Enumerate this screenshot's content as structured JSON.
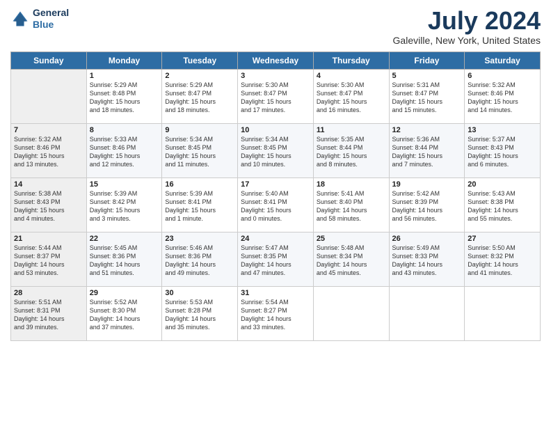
{
  "logo": {
    "line1": "General",
    "line2": "Blue"
  },
  "header": {
    "month": "July 2024",
    "location": "Galeville, New York, United States"
  },
  "days_of_week": [
    "Sunday",
    "Monday",
    "Tuesday",
    "Wednesday",
    "Thursday",
    "Friday",
    "Saturday"
  ],
  "weeks": [
    [
      {
        "num": "",
        "info": ""
      },
      {
        "num": "1",
        "info": "Sunrise: 5:29 AM\nSunset: 8:48 PM\nDaylight: 15 hours\nand 18 minutes."
      },
      {
        "num": "2",
        "info": "Sunrise: 5:29 AM\nSunset: 8:47 PM\nDaylight: 15 hours\nand 18 minutes."
      },
      {
        "num": "3",
        "info": "Sunrise: 5:30 AM\nSunset: 8:47 PM\nDaylight: 15 hours\nand 17 minutes."
      },
      {
        "num": "4",
        "info": "Sunrise: 5:30 AM\nSunset: 8:47 PM\nDaylight: 15 hours\nand 16 minutes."
      },
      {
        "num": "5",
        "info": "Sunrise: 5:31 AM\nSunset: 8:47 PM\nDaylight: 15 hours\nand 15 minutes."
      },
      {
        "num": "6",
        "info": "Sunrise: 5:32 AM\nSunset: 8:46 PM\nDaylight: 15 hours\nand 14 minutes."
      }
    ],
    [
      {
        "num": "7",
        "info": "Sunrise: 5:32 AM\nSunset: 8:46 PM\nDaylight: 15 hours\nand 13 minutes."
      },
      {
        "num": "8",
        "info": "Sunrise: 5:33 AM\nSunset: 8:46 PM\nDaylight: 15 hours\nand 12 minutes."
      },
      {
        "num": "9",
        "info": "Sunrise: 5:34 AM\nSunset: 8:45 PM\nDaylight: 15 hours\nand 11 minutes."
      },
      {
        "num": "10",
        "info": "Sunrise: 5:34 AM\nSunset: 8:45 PM\nDaylight: 15 hours\nand 10 minutes."
      },
      {
        "num": "11",
        "info": "Sunrise: 5:35 AM\nSunset: 8:44 PM\nDaylight: 15 hours\nand 8 minutes."
      },
      {
        "num": "12",
        "info": "Sunrise: 5:36 AM\nSunset: 8:44 PM\nDaylight: 15 hours\nand 7 minutes."
      },
      {
        "num": "13",
        "info": "Sunrise: 5:37 AM\nSunset: 8:43 PM\nDaylight: 15 hours\nand 6 minutes."
      }
    ],
    [
      {
        "num": "14",
        "info": "Sunrise: 5:38 AM\nSunset: 8:43 PM\nDaylight: 15 hours\nand 4 minutes."
      },
      {
        "num": "15",
        "info": "Sunrise: 5:39 AM\nSunset: 8:42 PM\nDaylight: 15 hours\nand 3 minutes."
      },
      {
        "num": "16",
        "info": "Sunrise: 5:39 AM\nSunset: 8:41 PM\nDaylight: 15 hours\nand 1 minute."
      },
      {
        "num": "17",
        "info": "Sunrise: 5:40 AM\nSunset: 8:41 PM\nDaylight: 15 hours\nand 0 minutes."
      },
      {
        "num": "18",
        "info": "Sunrise: 5:41 AM\nSunset: 8:40 PM\nDaylight: 14 hours\nand 58 minutes."
      },
      {
        "num": "19",
        "info": "Sunrise: 5:42 AM\nSunset: 8:39 PM\nDaylight: 14 hours\nand 56 minutes."
      },
      {
        "num": "20",
        "info": "Sunrise: 5:43 AM\nSunset: 8:38 PM\nDaylight: 14 hours\nand 55 minutes."
      }
    ],
    [
      {
        "num": "21",
        "info": "Sunrise: 5:44 AM\nSunset: 8:37 PM\nDaylight: 14 hours\nand 53 minutes."
      },
      {
        "num": "22",
        "info": "Sunrise: 5:45 AM\nSunset: 8:36 PM\nDaylight: 14 hours\nand 51 minutes."
      },
      {
        "num": "23",
        "info": "Sunrise: 5:46 AM\nSunset: 8:36 PM\nDaylight: 14 hours\nand 49 minutes."
      },
      {
        "num": "24",
        "info": "Sunrise: 5:47 AM\nSunset: 8:35 PM\nDaylight: 14 hours\nand 47 minutes."
      },
      {
        "num": "25",
        "info": "Sunrise: 5:48 AM\nSunset: 8:34 PM\nDaylight: 14 hours\nand 45 minutes."
      },
      {
        "num": "26",
        "info": "Sunrise: 5:49 AM\nSunset: 8:33 PM\nDaylight: 14 hours\nand 43 minutes."
      },
      {
        "num": "27",
        "info": "Sunrise: 5:50 AM\nSunset: 8:32 PM\nDaylight: 14 hours\nand 41 minutes."
      }
    ],
    [
      {
        "num": "28",
        "info": "Sunrise: 5:51 AM\nSunset: 8:31 PM\nDaylight: 14 hours\nand 39 minutes."
      },
      {
        "num": "29",
        "info": "Sunrise: 5:52 AM\nSunset: 8:30 PM\nDaylight: 14 hours\nand 37 minutes."
      },
      {
        "num": "30",
        "info": "Sunrise: 5:53 AM\nSunset: 8:28 PM\nDaylight: 14 hours\nand 35 minutes."
      },
      {
        "num": "31",
        "info": "Sunrise: 5:54 AM\nSunset: 8:27 PM\nDaylight: 14 hours\nand 33 minutes."
      },
      {
        "num": "",
        "info": ""
      },
      {
        "num": "",
        "info": ""
      },
      {
        "num": "",
        "info": ""
      }
    ]
  ]
}
